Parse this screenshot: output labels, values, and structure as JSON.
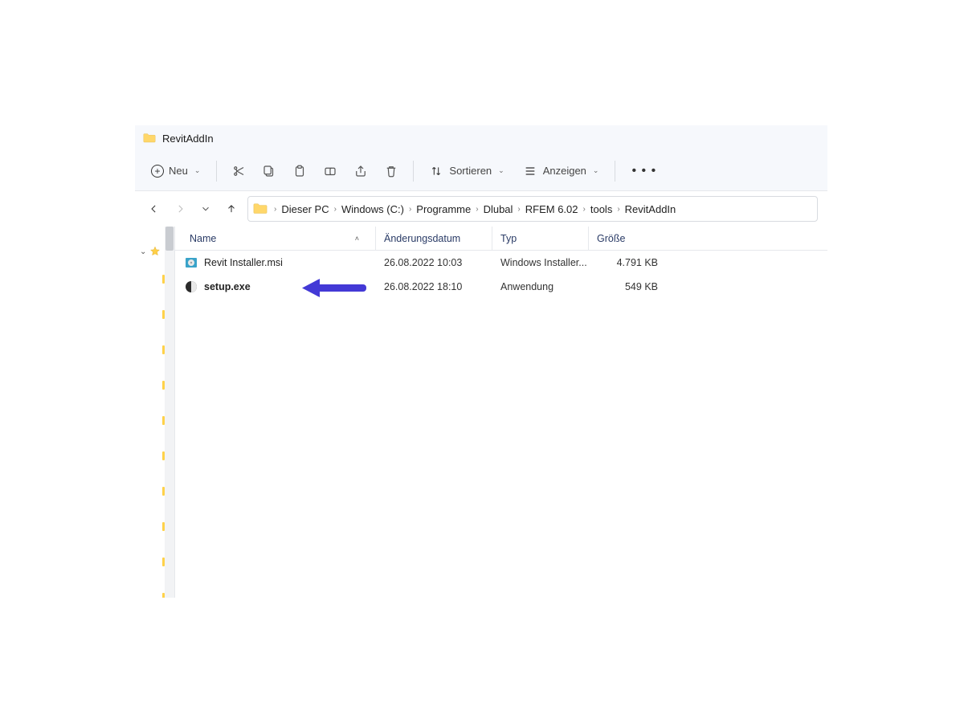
{
  "window": {
    "title": "RevitAddIn"
  },
  "toolbar": {
    "new_label": "Neu",
    "sort_label": "Sortieren",
    "view_label": "Anzeigen"
  },
  "breadcrumbs": [
    "Dieser PC",
    "Windows (C:)",
    "Programme",
    "Dlubal",
    "RFEM 6.02",
    "tools",
    "RevitAddIn"
  ],
  "columns": {
    "name": "Name",
    "date": "Änderungsdatum",
    "type": "Typ",
    "size": "Größe"
  },
  "files": [
    {
      "name": "Revit Installer.msi",
      "date": "26.08.2022 10:03",
      "type": "Windows Installer...",
      "size": "4.791 KB",
      "icon": "msi",
      "highlighted": false
    },
    {
      "name": "setup.exe",
      "date": "26.08.2022 18:10",
      "type": "Anwendung",
      "size": "549 KB",
      "icon": "exe",
      "highlighted": true
    }
  ]
}
